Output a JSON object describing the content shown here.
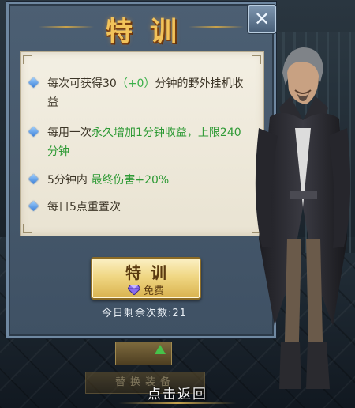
{
  "panel": {
    "title": "特训",
    "close_glyph": "✕"
  },
  "rules": [
    {
      "parts": [
        {
          "text": "每次可获得30",
          "color": ""
        },
        {
          "text": "（+0）",
          "color": "green"
        },
        {
          "text": "分钟的野外挂机收益",
          "color": ""
        }
      ]
    },
    {
      "parts": [
        {
          "text": "每用一次",
          "color": ""
        },
        {
          "text": "永久增加1分钟收益，上限240分钟",
          "color": "green"
        }
      ]
    },
    {
      "parts": [
        {
          "text": "5分钟内 ",
          "color": ""
        },
        {
          "text": "最终伤害+20%",
          "color": "green"
        }
      ]
    },
    {
      "parts": [
        {
          "text": "每日5点重置次",
          "color": ""
        }
      ]
    }
  ],
  "train_button": {
    "label": "特训",
    "sub_label": "免费",
    "icon": "gem-icon"
  },
  "remaining": {
    "label": "今日剩余次数:21"
  },
  "background": {
    "swap_label": "替换装备",
    "return_label": "点击返回"
  },
  "colors": {
    "title": "#f2c35a",
    "highlight": "#2e9a35",
    "panel": "#4c5f73"
  }
}
